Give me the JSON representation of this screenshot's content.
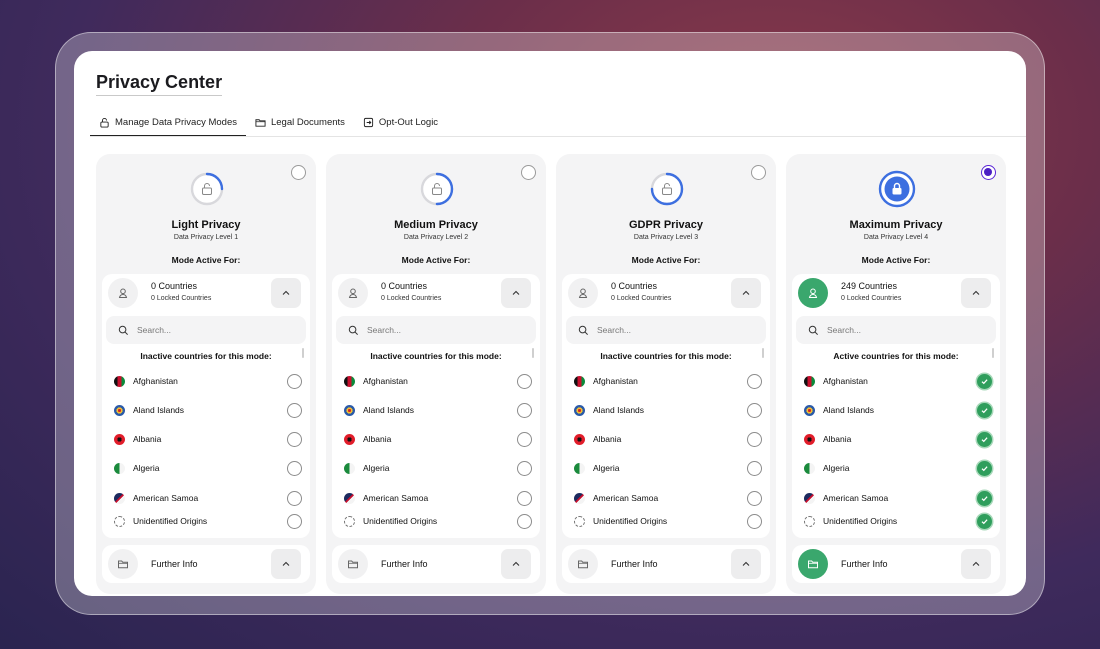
{
  "page": {
    "title": "Privacy Center"
  },
  "tabs": [
    {
      "label": "Manage Data Privacy Modes",
      "icon": "lock-icon",
      "active": true
    },
    {
      "label": "Legal Documents",
      "icon": "folder-icon",
      "active": false
    },
    {
      "label": "Opt-Out Logic",
      "icon": "exit-icon",
      "active": false
    }
  ],
  "colors": {
    "accent": "#3d6fe0",
    "active_green": "#2f9e5c",
    "selected_purple": "#4b1fc4"
  },
  "cards": [
    {
      "name": "Light Privacy",
      "level": "Data Privacy Level 1",
      "progress": 0.25,
      "selected": false,
      "mode_active_for": "Mode Active For:",
      "countries_count": "0 Countries",
      "locked_count": "0 Locked Countries",
      "search_placeholder": "Search...",
      "list_heading": "Inactive countries for this mode:",
      "checked": false,
      "further_info": "Further Info"
    },
    {
      "name": "Medium Privacy",
      "level": "Data Privacy Level 2",
      "progress": 0.5,
      "selected": false,
      "mode_active_for": "Mode Active For:",
      "countries_count": "0 Countries",
      "locked_count": "0 Locked Countries",
      "search_placeholder": "Search...",
      "list_heading": "Inactive countries for this mode:",
      "checked": false,
      "further_info": "Further Info"
    },
    {
      "name": "GDPR Privacy",
      "level": "Data Privacy Level 3",
      "progress": 0.75,
      "selected": false,
      "mode_active_for": "Mode Active For:",
      "countries_count": "0 Countries",
      "locked_count": "0 Locked Countries",
      "search_placeholder": "Search...",
      "list_heading": "Inactive countries for this mode:",
      "checked": false,
      "further_info": "Further Info"
    },
    {
      "name": "Maximum Privacy",
      "level": "Data Privacy Level 4",
      "progress": 1.0,
      "selected": true,
      "mode_active_for": "Mode Active For:",
      "countries_count": "249 Countries",
      "locked_count": "0 Locked Countries",
      "search_placeholder": "Search...",
      "list_heading": "Active countries for this mode:",
      "checked": true,
      "further_info": "Further Info"
    }
  ],
  "countries": [
    {
      "name": "Afghanistan",
      "flag": "afghanistan-flag-icon"
    },
    {
      "name": "Aland Islands",
      "flag": "aland-islands-flag-icon"
    },
    {
      "name": "Albania",
      "flag": "albania-flag-icon"
    },
    {
      "name": "Algeria",
      "flag": "algeria-flag-icon"
    },
    {
      "name": "American Samoa",
      "flag": "american-samoa-flag-icon"
    },
    {
      "name": "Unidentified Origins",
      "flag": "unidentified-origin-icon"
    }
  ]
}
